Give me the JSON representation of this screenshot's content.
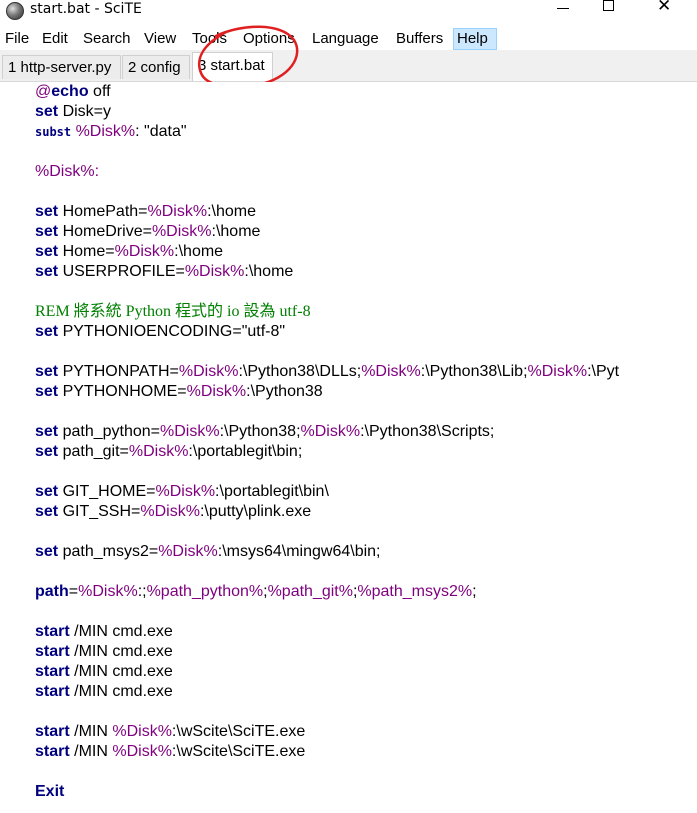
{
  "window": {
    "title": "start.bat - SciTE",
    "close_glyph": "✕"
  },
  "menu": {
    "items": [
      "File",
      "Edit",
      "Search",
      "View",
      "Tools",
      "Options",
      "Language",
      "Buffers",
      "Help"
    ],
    "active_item": "Help"
  },
  "tabs": [
    {
      "label": "1 http-server.py",
      "active": false
    },
    {
      "label": "2 config",
      "active": false
    },
    {
      "label": "3 start.bat",
      "active": true
    }
  ],
  "annotation": {
    "color": "#e02020",
    "target": "tab-3"
  },
  "colors": {
    "keyword": "#00007f",
    "variable": "#7f007f",
    "comment": "#007f00",
    "text": "#000000"
  },
  "code": {
    "lines": [
      [
        {
          "t": "@",
          "c": "at"
        },
        {
          "t": "echo",
          "c": "kw"
        },
        {
          "t": " off",
          "c": ""
        }
      ],
      [
        {
          "t": "set",
          "c": "kw"
        },
        {
          "t": " Disk=y",
          "c": ""
        }
      ],
      [
        {
          "t": "subst",
          "c": "kw-small"
        },
        {
          "t": " ",
          "c": ""
        },
        {
          "t": "%Disk%",
          "c": "var"
        },
        {
          "t": ": \"data\"",
          "c": ""
        }
      ],
      [],
      [
        {
          "t": "%Disk%",
          "c": "var"
        },
        {
          "t": ":",
          "c": "var"
        }
      ],
      [],
      [
        {
          "t": "set",
          "c": "kw"
        },
        {
          "t": " HomePath=",
          "c": ""
        },
        {
          "t": "%Disk%",
          "c": "var"
        },
        {
          "t": ":\\home",
          "c": ""
        }
      ],
      [
        {
          "t": "set",
          "c": "kw"
        },
        {
          "t": " HomeDrive=",
          "c": ""
        },
        {
          "t": "%Disk%",
          "c": "var"
        },
        {
          "t": ":\\home",
          "c": ""
        }
      ],
      [
        {
          "t": "set",
          "c": "kw"
        },
        {
          "t": " Home=",
          "c": ""
        },
        {
          "t": "%Disk%",
          "c": "var"
        },
        {
          "t": ":\\home",
          "c": ""
        }
      ],
      [
        {
          "t": "set",
          "c": "kw"
        },
        {
          "t": " USERPROFILE=",
          "c": ""
        },
        {
          "t": "%Disk%",
          "c": "var"
        },
        {
          "t": ":\\home",
          "c": ""
        }
      ],
      [],
      [
        {
          "t": "REM 將系統 Python 程式的 io 設為 utf-8",
          "c": "rem"
        }
      ],
      [
        {
          "t": "set",
          "c": "kw"
        },
        {
          "t": " PYTHONIOENCODING=\"utf-8\"",
          "c": ""
        }
      ],
      [],
      [
        {
          "t": "set",
          "c": "kw"
        },
        {
          "t": " PYTHONPATH=",
          "c": ""
        },
        {
          "t": "%Disk%",
          "c": "var"
        },
        {
          "t": ":\\Python38\\DLLs;",
          "c": ""
        },
        {
          "t": "%Disk%",
          "c": "var"
        },
        {
          "t": ":\\Python38\\Lib;",
          "c": ""
        },
        {
          "t": "%Disk%",
          "c": "var"
        },
        {
          "t": ":\\Pyt",
          "c": ""
        }
      ],
      [
        {
          "t": "set",
          "c": "kw"
        },
        {
          "t": " PYTHONHOME=",
          "c": ""
        },
        {
          "t": "%Disk%",
          "c": "var"
        },
        {
          "t": ":\\Python38",
          "c": ""
        }
      ],
      [],
      [
        {
          "t": "set",
          "c": "kw"
        },
        {
          "t": " path_python=",
          "c": ""
        },
        {
          "t": "%Disk%",
          "c": "var"
        },
        {
          "t": ":\\Python38;",
          "c": ""
        },
        {
          "t": "%Disk%",
          "c": "var"
        },
        {
          "t": ":\\Python38\\Scripts;",
          "c": ""
        }
      ],
      [
        {
          "t": "set",
          "c": "kw"
        },
        {
          "t": " path_git=",
          "c": ""
        },
        {
          "t": "%Disk%",
          "c": "var"
        },
        {
          "t": ":\\portablegit\\bin;",
          "c": ""
        }
      ],
      [],
      [
        {
          "t": "set",
          "c": "kw"
        },
        {
          "t": " GIT_HOME=",
          "c": ""
        },
        {
          "t": "%Disk%",
          "c": "var"
        },
        {
          "t": ":\\portablegit\\bin\\",
          "c": ""
        }
      ],
      [
        {
          "t": "set",
          "c": "kw"
        },
        {
          "t": " GIT_SSH=",
          "c": ""
        },
        {
          "t": "%Disk%",
          "c": "var"
        },
        {
          "t": ":\\putty\\plink.exe",
          "c": ""
        }
      ],
      [],
      [
        {
          "t": "set",
          "c": "kw"
        },
        {
          "t": " path_msys2=",
          "c": ""
        },
        {
          "t": "%Disk%",
          "c": "var"
        },
        {
          "t": ":\\msys64\\mingw64\\bin;",
          "c": ""
        }
      ],
      [],
      [
        {
          "t": "path",
          "c": "kw"
        },
        {
          "t": "=",
          "c": ""
        },
        {
          "t": "%Disk%",
          "c": "var"
        },
        {
          "t": ":;",
          "c": ""
        },
        {
          "t": "%path_python%",
          "c": "var"
        },
        {
          "t": ";",
          "c": ""
        },
        {
          "t": "%path_git%",
          "c": "var"
        },
        {
          "t": ";",
          "c": ""
        },
        {
          "t": "%path_msys2%",
          "c": "var"
        },
        {
          "t": ";",
          "c": ""
        }
      ],
      [],
      [
        {
          "t": "start",
          "c": "kw"
        },
        {
          "t": " /MIN cmd.exe",
          "c": ""
        }
      ],
      [
        {
          "t": "start",
          "c": "kw"
        },
        {
          "t": " /MIN cmd.exe",
          "c": ""
        }
      ],
      [
        {
          "t": "start",
          "c": "kw"
        },
        {
          "t": " /MIN cmd.exe",
          "c": ""
        }
      ],
      [
        {
          "t": "start",
          "c": "kw"
        },
        {
          "t": " /MIN cmd.exe",
          "c": ""
        }
      ],
      [],
      [
        {
          "t": "start",
          "c": "kw"
        },
        {
          "t": " /MIN ",
          "c": ""
        },
        {
          "t": "%Disk%",
          "c": "var"
        },
        {
          "t": ":\\wScite\\SciTE.exe",
          "c": ""
        }
      ],
      [
        {
          "t": "start",
          "c": "kw"
        },
        {
          "t": " /MIN ",
          "c": ""
        },
        {
          "t": "%Disk%",
          "c": "var"
        },
        {
          "t": ":\\wScite\\SciTE.exe",
          "c": ""
        }
      ],
      [],
      [
        {
          "t": "Exit",
          "c": "kw"
        }
      ]
    ]
  }
}
